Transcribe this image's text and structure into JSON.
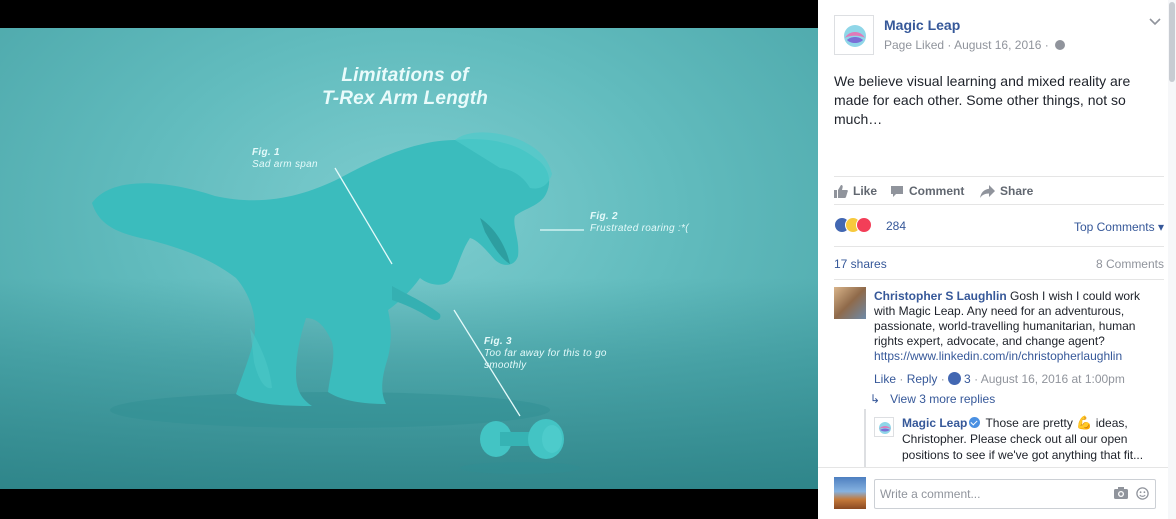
{
  "photo": {
    "title_line1": "Limitations of",
    "title_line2": "T-Rex Arm Length",
    "fig1": {
      "num": "Fig. 1",
      "text": "Sad arm span"
    },
    "fig2": {
      "num": "Fig. 2",
      "text": "Frustrated roaring :*("
    },
    "fig3": {
      "num": "Fig. 3",
      "text": "Too far away for this to go smoothly"
    },
    "bg_color": "#62bcbe",
    "dino_color": "#3bbcbd"
  },
  "post": {
    "page_name": "Magic Leap",
    "meta_status": "Page Liked",
    "meta_separator": " · ",
    "meta_date": "August 16, 2016",
    "meta_dot": " · ",
    "text": "We believe visual learning and mixed reality are made for each other. Some other things, not so much…"
  },
  "actions": {
    "like": "Like",
    "comment": "Comment",
    "share": "Share"
  },
  "reactions": {
    "count": "284",
    "sort_label": "Top Comments ▾"
  },
  "stats": {
    "shares": "17 shares",
    "comments": "8 Comments"
  },
  "comment": {
    "author": "Christopher S Laughlin",
    "text": " Gosh I wish I could work with Magic Leap. Any need for an adventurous, passionate, world-travelling humanitarian, human rights expert, advocate, and change agent?",
    "link": "https://www.linkedin.com/in/christopherlaughlin",
    "like": "Like",
    "sep1": " · ",
    "reply": "Reply",
    "sep2": " · ",
    "like_count": "3",
    "sep3": " · ",
    "time": "August 16, 2016 at 1:00pm"
  },
  "view_replies": "View 3 more replies",
  "reply": {
    "author": "Magic Leap",
    "text_before": " Those are pretty ",
    "text_after": " ideas, Christopher. Please check out all our open positions to see if we've got anything that fit..."
  },
  "compose": {
    "placeholder": "Write a comment..."
  },
  "colors": {
    "link": "#365899",
    "muted": "#90949c",
    "like_blue": "#4267b2"
  }
}
